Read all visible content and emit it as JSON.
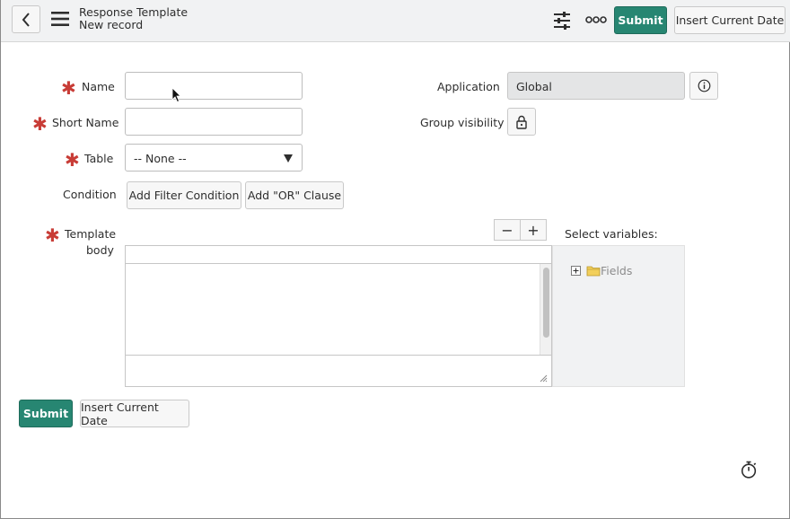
{
  "header": {
    "title": "Response Template",
    "subtitle": "New record",
    "submit_label": "Submit",
    "insert_date_label": "Insert Current Date"
  },
  "form": {
    "name": {
      "label": "Name",
      "value": ""
    },
    "short_name": {
      "label": "Short Name",
      "value": ""
    },
    "table": {
      "label": "Table",
      "selected": "-- None --"
    },
    "condition": {
      "label": "Condition",
      "add_filter_label": "Add Filter Condition",
      "add_or_label": "Add \"OR\" Clause"
    },
    "template_body": {
      "label_line1": "Template",
      "label_line2": "body",
      "minus": "−",
      "plus": "+"
    },
    "application": {
      "label": "Application",
      "value": "Global"
    },
    "group_visibility": {
      "label": "Group visibility"
    },
    "select_variables": {
      "label": "Select variables:",
      "tree_root": "Fields"
    }
  },
  "footer": {
    "submit_label": "Submit",
    "insert_date_label": "Insert Current Date"
  },
  "colors": {
    "primary": "#278672",
    "required": "#c83c36",
    "header_bg": "#f1f2f3"
  },
  "icons": [
    "back-arrow-icon",
    "hamburger-menu-icon",
    "sliders-icon",
    "more-options-icon",
    "info-icon",
    "lock-icon",
    "folder-icon",
    "stopwatch-icon"
  ]
}
